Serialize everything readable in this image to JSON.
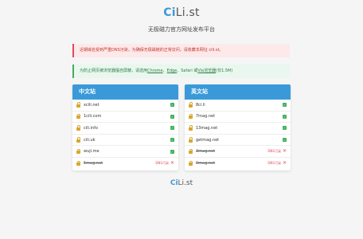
{
  "header": {
    "logo_ci": "Ci",
    "logo_rest": "Li.st",
    "subtitle": "无极磁力官方网址发布平台"
  },
  "alerts": {
    "dns_warning": "近期域名受到严重DNS污染，为确保无极磁链的正常访问，请收藏本网址 cili.st。",
    "browser_prefix": "为防止网页被浏览器擅自屏蔽，请选用",
    "browser_chrome": "Chrome",
    "browser_sep1": "、",
    "browser_edge": "Edge",
    "browser_sep2": "、Safari 或",
    "browser_via": "Via浏览器",
    "browser_suffix": "(仅1.5M)"
  },
  "cards": {
    "chinese": {
      "title": "中文站",
      "sites": [
        {
          "domain": "xcili.net",
          "status": "ok"
        },
        {
          "domain": "1cili.com",
          "status": "ok"
        },
        {
          "domain": "cili.info",
          "status": "ok"
        },
        {
          "domain": "cili.uk",
          "status": "ok"
        },
        {
          "domain": "wuji.me",
          "status": "ok"
        },
        {
          "domain": "5mag.net",
          "status": "dns",
          "dns_label": "DNS污染"
        }
      ]
    },
    "english": {
      "title": "英文站",
      "sites": [
        {
          "domain": "8ci.li",
          "status": "ok"
        },
        {
          "domain": "7mag.net",
          "status": "ok"
        },
        {
          "domain": "13mag.net",
          "status": "ok"
        },
        {
          "domain": "getmag.net",
          "status": "ok"
        },
        {
          "domain": "3mag.net",
          "status": "dns",
          "dns_label": "DNS污染"
        },
        {
          "domain": "0mag.net",
          "status": "dns",
          "dns_label": "DNS污染"
        }
      ]
    }
  },
  "footer": {
    "logo_ci": "Ci",
    "logo_rest": "Li.st"
  },
  "icons": {
    "lock": "lock-icon",
    "check": "check-icon",
    "cross": "cross-icon"
  },
  "colors": {
    "brand_blue": "#3a9ad9",
    "alert_red": "#e24b5b",
    "alert_green": "#3fae5b",
    "lock_gold": "#d9a62e"
  }
}
